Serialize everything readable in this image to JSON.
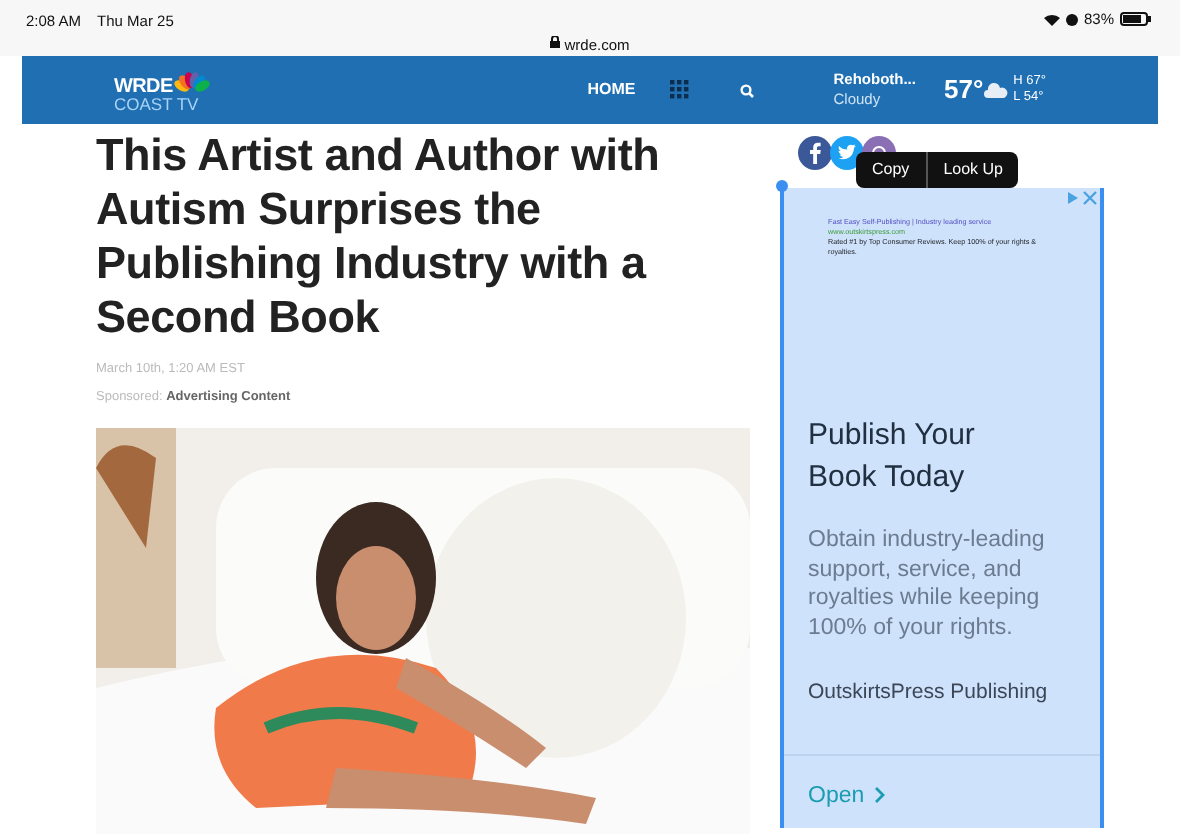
{
  "status_bar": {
    "time": "2:08 AM",
    "date": "Thu Mar 25",
    "battery": "83%"
  },
  "address_bar": {
    "url": "wrde.com"
  },
  "nav": {
    "logo": {
      "line1": "WRDE",
      "line2": "COAST TV"
    },
    "items": [
      "HOME"
    ],
    "weather": {
      "location": "Rehoboth...",
      "condition": "Cloudy",
      "temp": "57°",
      "high": "H 67°",
      "low": "L 54°"
    }
  },
  "article": {
    "title": "This Artist and Author with Autism Surprises the Publishing Industry with a Second Book",
    "date": "March 10th, 1:20 AM EST",
    "sponsored_label": "Sponsored:",
    "sponsored_value": "Advertising Content"
  },
  "context_menu": {
    "items": [
      "Copy",
      "Look Up"
    ]
  },
  "ad": {
    "small_title": "Fast Easy Self-Publishing | Industry leading service",
    "small_url": "www.outskirtspress.com",
    "small_text": "Rated #1 by Top Consumer Reviews. Keep 100% of your rights & royalties.",
    "headline": "Publish Your Book Today",
    "body": "Obtain industry-leading support, service, and royalties while keeping 100% of your rights.",
    "advertiser": "OutskirtsPress Publishing",
    "cta": "Open"
  }
}
